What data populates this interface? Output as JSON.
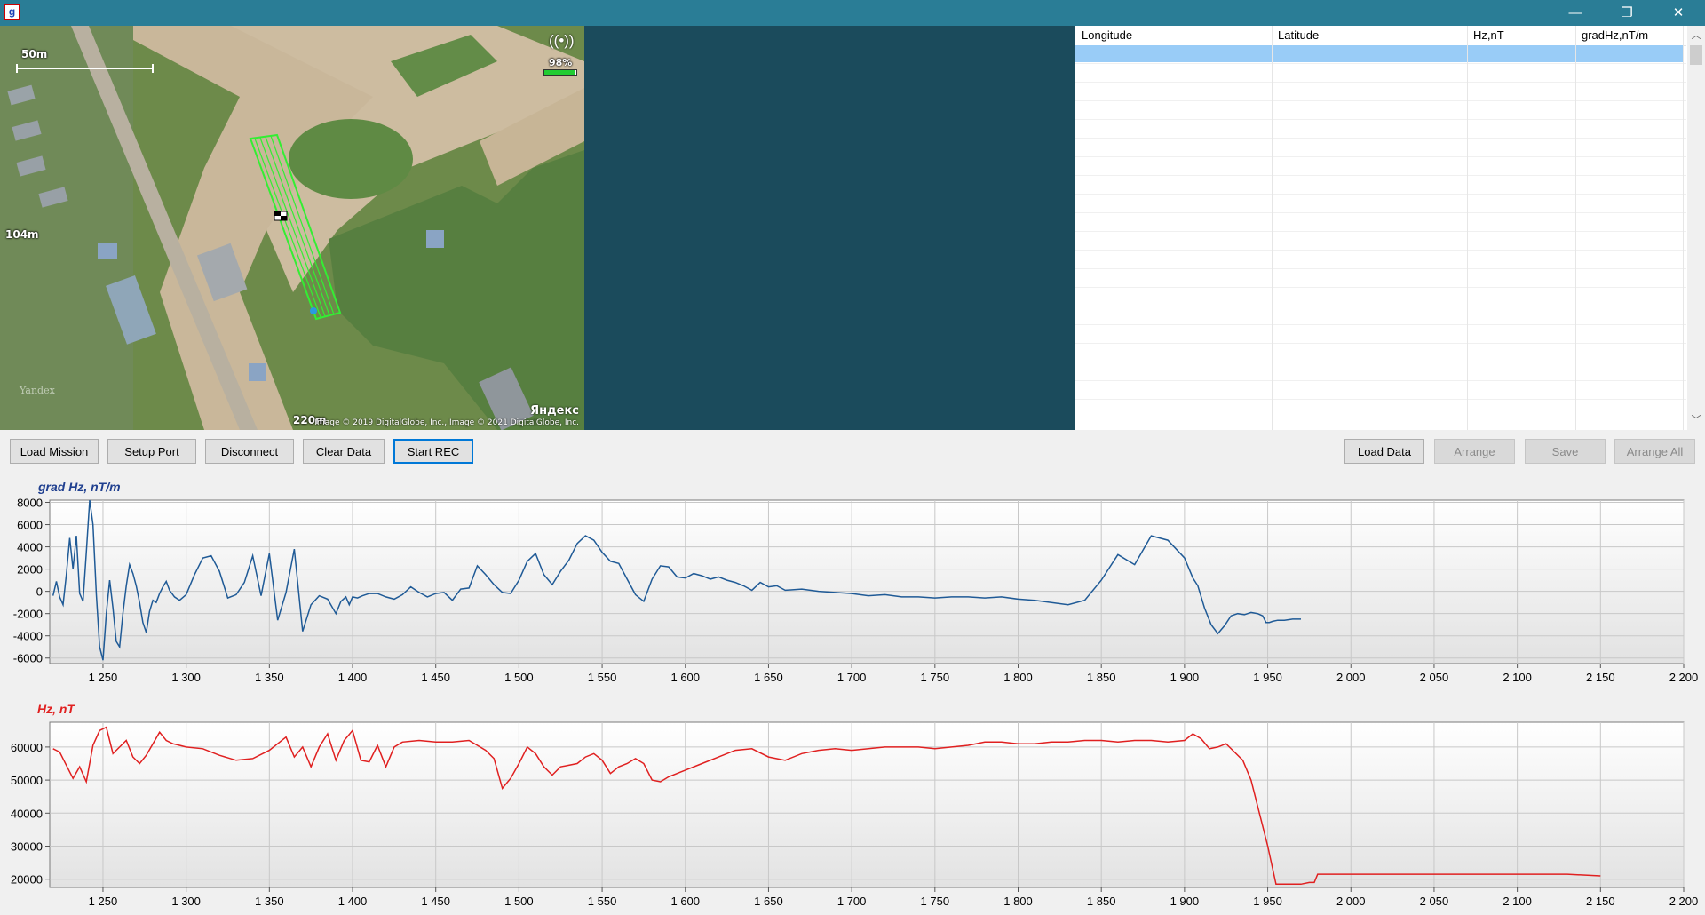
{
  "window": {
    "app_icon_glyph": "g",
    "minimize": "—",
    "restore": "❐",
    "close": "✕"
  },
  "map": {
    "scale_top": "50m",
    "scale_left": "104m",
    "scale_bottom": "220m",
    "signal_percent": "98%",
    "signal_level": 0.98,
    "watermark": "Yandex",
    "logo": "Яндекс",
    "copyright": "Image © 2019 DigitalGlobe, Inc., Image © 2021 DigitalGlobe, Inc."
  },
  "table": {
    "columns": [
      "Longitude",
      "Latitude",
      "Hz,nT",
      "gradHz,nT/m"
    ],
    "rows": []
  },
  "toolbar": {
    "load_mission": "Load Mission",
    "setup_port": "Setup Port",
    "disconnect": "Disconnect",
    "clear_data": "Clear Data",
    "start_rec": "Start REC",
    "load_data": "Load Data",
    "arrange": "Arrange",
    "save": "Save",
    "arrange_all": "Arrange All"
  },
  "colors": {
    "titlebar": "#2a7d96",
    "dark_panel": "#1b4b5c",
    "grad_series": "#1f5a96",
    "hz_series": "#e02020",
    "selected_row": "#99ccf7",
    "mission_track": "#33ee33"
  },
  "chart_data": [
    {
      "type": "line",
      "title": "grad Hz, nT/m",
      "title_color": "#1f3f8f",
      "series_color": "#1f5a96",
      "xlim": [
        1218,
        2200
      ],
      "ylim": [
        -6500,
        8200
      ],
      "yticks": [
        8000,
        6000,
        4000,
        2000,
        0,
        -2000,
        -4000,
        -6000
      ],
      "ytick_labels": [
        "8000",
        "6000",
        "4000",
        "2000",
        "0",
        "-2000",
        "-4000",
        "-6000"
      ],
      "xticks": [
        1250,
        1300,
        1350,
        1400,
        1450,
        1500,
        1550,
        1600,
        1650,
        1700,
        1750,
        1800,
        1850,
        1900,
        1950,
        2000,
        2050,
        2100,
        2150,
        2200
      ],
      "xtick_labels": [
        "1 250",
        "1 300",
        "1 350",
        "1 400",
        "1 450",
        "1 500",
        "1 550",
        "1 600",
        "1 650",
        "1 700",
        "1 750",
        "1 800",
        "1 850",
        "1 900",
        "1 950",
        "2 000",
        "2 050",
        "2 100",
        "2 150",
        "2 200"
      ],
      "grid": true,
      "x": [
        1220,
        1222,
        1224,
        1226,
        1228,
        1230,
        1232,
        1234,
        1236,
        1238,
        1240,
        1242,
        1244,
        1246,
        1248,
        1250,
        1252,
        1254,
        1256,
        1258,
        1260,
        1262,
        1264,
        1266,
        1268,
        1270,
        1272,
        1274,
        1276,
        1278,
        1280,
        1282,
        1284,
        1286,
        1288,
        1290,
        1293,
        1296,
        1300,
        1305,
        1310,
        1315,
        1320,
        1325,
        1330,
        1335,
        1340,
        1345,
        1350,
        1355,
        1360,
        1365,
        1370,
        1375,
        1380,
        1385,
        1390,
        1393,
        1396,
        1398,
        1400,
        1403,
        1406,
        1410,
        1415,
        1420,
        1425,
        1430,
        1435,
        1440,
        1445,
        1450,
        1455,
        1460,
        1465,
        1470,
        1475,
        1480,
        1485,
        1490,
        1495,
        1500,
        1505,
        1510,
        1515,
        1520,
        1525,
        1530,
        1535,
        1540,
        1545,
        1550,
        1555,
        1560,
        1565,
        1570,
        1575,
        1580,
        1585,
        1590,
        1595,
        1600,
        1605,
        1610,
        1615,
        1620,
        1625,
        1630,
        1635,
        1640,
        1645,
        1650,
        1655,
        1660,
        1670,
        1680,
        1690,
        1700,
        1710,
        1720,
        1730,
        1740,
        1750,
        1760,
        1770,
        1780,
        1790,
        1800,
        1810,
        1820,
        1830,
        1840,
        1850,
        1860,
        1870,
        1880,
        1890,
        1900,
        1905,
        1908,
        1912,
        1916,
        1920,
        1924,
        1928,
        1932,
        1936,
        1940,
        1944,
        1947,
        1949,
        1951,
        1953,
        1956,
        1960,
        1965,
        1970,
        1975,
        1978,
        1980,
        1990,
        2000,
        2020,
        2050,
        2100,
        2150
      ],
      "values": [
        -400,
        900,
        -500,
        -1200,
        1500,
        4800,
        2000,
        5000,
        -200,
        -900,
        3500,
        8200,
        6000,
        -300,
        -5000,
        -6200,
        -2000,
        1000,
        -1500,
        -4500,
        -5000,
        -2000,
        500,
        2400,
        1600,
        500,
        -1000,
        -2800,
        -3700,
        -1800,
        -800,
        -1000,
        -200,
        400,
        900,
        100,
        -500,
        -800,
        -300,
        1500,
        3000,
        3200,
        1800,
        -600,
        -300,
        800,
        3200,
        -400,
        3400,
        -2600,
        -100,
        3800,
        -3600,
        -1200,
        -400,
        -700,
        -2000,
        -900,
        -500,
        -1200,
        -500,
        -600,
        -400,
        -200,
        -200,
        -500,
        -700,
        -300,
        400,
        -100,
        -500,
        -200,
        -100,
        -800,
        200,
        300,
        2300,
        1500,
        600,
        -100,
        -200,
        1000,
        2700,
        3400,
        1500,
        600,
        1800,
        2800,
        4300,
        5000,
        4600,
        3500,
        2700,
        2500,
        1100,
        -300,
        -900,
        1100,
        2300,
        2200,
        1300,
        1200,
        1600,
        1400,
        1100,
        1300,
        1000,
        800,
        500,
        100,
        800,
        400,
        500,
        100,
        200,
        0,
        -100,
        -200,
        -400,
        -300,
        -500,
        -500,
        -600,
        -500,
        -500,
        -600,
        -500,
        -700,
        -800,
        -1000,
        -1200,
        -800,
        1000,
        3300,
        2400,
        5000,
        4600,
        3000,
        1200,
        500,
        -1500,
        -3000,
        -3800,
        -3100,
        -2200,
        -2000,
        -2100,
        -1900,
        -2000,
        -2200,
        -2800,
        -2800,
        -2700,
        -2600,
        -2600,
        -2500,
        -2500
      ]
    },
    {
      "type": "line",
      "title": "Hz, nT",
      "title_color": "#e02020",
      "series_color": "#e02020",
      "xlim": [
        1218,
        2200
      ],
      "ylim": [
        17500,
        67500
      ],
      "yticks": [
        60000,
        50000,
        40000,
        30000,
        20000
      ],
      "ytick_labels": [
        "60000",
        "50000",
        "40000",
        "30000",
        "20000"
      ],
      "xticks": [
        1250,
        1300,
        1350,
        1400,
        1450,
        1500,
        1550,
        1600,
        1650,
        1700,
        1750,
        1800,
        1850,
        1900,
        1950,
        2000,
        2050,
        2100,
        2150,
        2200
      ],
      "xtick_labels": [
        "1 250",
        "1 300",
        "1 350",
        "1 400",
        "1 450",
        "1 500",
        "1 550",
        "1 600",
        "1 650",
        "1 700",
        "1 750",
        "1 800",
        "1 850",
        "1 900",
        "1 950",
        "2 000",
        "2 050",
        "2 100",
        "2 150",
        "2 200"
      ],
      "grid": true,
      "x": [
        1220,
        1224,
        1228,
        1232,
        1236,
        1240,
        1244,
        1248,
        1252,
        1256,
        1260,
        1264,
        1268,
        1272,
        1276,
        1280,
        1284,
        1288,
        1292,
        1296,
        1300,
        1310,
        1320,
        1330,
        1340,
        1350,
        1360,
        1365,
        1370,
        1375,
        1380,
        1385,
        1390,
        1395,
        1400,
        1405,
        1410,
        1415,
        1420,
        1425,
        1430,
        1440,
        1450,
        1460,
        1470,
        1475,
        1480,
        1485,
        1490,
        1495,
        1500,
        1505,
        1510,
        1515,
        1520,
        1525,
        1530,
        1535,
        1540,
        1545,
        1550,
        1555,
        1560,
        1565,
        1570,
        1575,
        1580,
        1585,
        1590,
        1600,
        1610,
        1620,
        1630,
        1640,
        1650,
        1660,
        1670,
        1680,
        1690,
        1700,
        1710,
        1720,
        1730,
        1740,
        1750,
        1760,
        1770,
        1780,
        1790,
        1800,
        1810,
        1820,
        1830,
        1840,
        1850,
        1860,
        1870,
        1880,
        1890,
        1900,
        1905,
        1910,
        1915,
        1920,
        1925,
        1930,
        1935,
        1940,
        1945,
        1950,
        1955,
        1960,
        1965,
        1970,
        1975,
        1978,
        1980,
        1990,
        2000,
        2050,
        2100,
        2130,
        2150
      ],
      "values": [
        59500,
        58500,
        54500,
        50500,
        54000,
        49500,
        60500,
        65000,
        66000,
        58000,
        60000,
        62000,
        57000,
        55000,
        57500,
        61000,
        64500,
        62000,
        61000,
        60500,
        60000,
        59500,
        57500,
        56000,
        56500,
        59000,
        63000,
        57000,
        60000,
        54000,
        60000,
        64000,
        56000,
        62000,
        65000,
        56000,
        55500,
        60500,
        54000,
        60000,
        61500,
        62000,
        61500,
        61500,
        62000,
        60500,
        59000,
        56500,
        47500,
        50500,
        55000,
        60000,
        58000,
        54000,
        51500,
        54000,
        54500,
        55000,
        57000,
        58000,
        56000,
        52000,
        54000,
        55000,
        56500,
        55000,
        50000,
        49500,
        51000,
        53000,
        55000,
        57000,
        59000,
        59500,
        57000,
        56000,
        58000,
        59000,
        59500,
        59000,
        59500,
        60000,
        60000,
        60000,
        59500,
        60000,
        60500,
        61500,
        61500,
        61000,
        61000,
        61500,
        61500,
        62000,
        62000,
        61500,
        62000,
        62000,
        61500,
        62000,
        64000,
        62500,
        59500,
        60000,
        61000,
        58500,
        56000,
        50000,
        40000,
        30000,
        18500,
        18500,
        18500,
        18500,
        19000,
        19000,
        21500,
        21500,
        21500,
        21500,
        21500,
        21500,
        21000
      ]
    }
  ]
}
